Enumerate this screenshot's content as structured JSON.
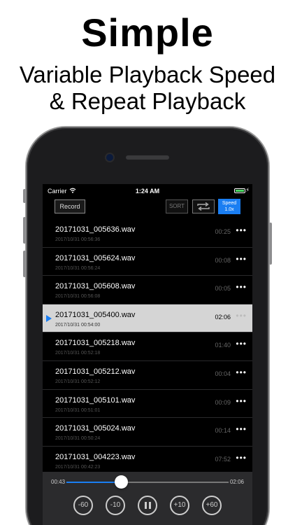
{
  "headline": {
    "title": "Simple",
    "subtitle_line1": "Variable Playback Speed",
    "subtitle_line2": "& Repeat Playback"
  },
  "status_bar": {
    "carrier": "Carrier",
    "time": "1:24 AM"
  },
  "toolbar": {
    "record_label": "Record",
    "sort_label": "SORT",
    "speed_label": "Speed",
    "speed_value": "1.0x"
  },
  "recordings": [
    {
      "name": "20171031_005636.wav",
      "date": "2017/10/31 00:56:36",
      "duration": "00:25",
      "selected": false
    },
    {
      "name": "20171031_005624.wav",
      "date": "2017/10/31 00:56:24",
      "duration": "00:08",
      "selected": false
    },
    {
      "name": "20171031_005608.wav",
      "date": "2017/10/31 00:56:08",
      "duration": "00:05",
      "selected": false
    },
    {
      "name": "20171031_005400.wav",
      "date": "2017/10/31 00:54:00",
      "duration": "02:06",
      "selected": true
    },
    {
      "name": "20171031_005218.wav",
      "date": "2017/10/31 00:52:18",
      "duration": "01:40",
      "selected": false
    },
    {
      "name": "20171031_005212.wav",
      "date": "2017/10/31 00:52:12",
      "duration": "00:04",
      "selected": false
    },
    {
      "name": "20171031_005101.wav",
      "date": "2017/10/31 00:51:01",
      "duration": "00:09",
      "selected": false
    },
    {
      "name": "20171031_005024.wav",
      "date": "2017/10/31 00:50:24",
      "duration": "00:14",
      "selected": false
    },
    {
      "name": "20171031_004223.wav",
      "date": "2017/10/31 00:42:23",
      "duration": "07:52",
      "selected": false
    }
  ],
  "more_glyph": "•••",
  "player": {
    "elapsed": "00:43",
    "total": "02:06",
    "progress": 0.34,
    "skip_back_60": "-60",
    "skip_back_10": "-10",
    "skip_fwd_10": "+10",
    "skip_fwd_60": "+60"
  },
  "colors": {
    "accent": "#1a7ef2",
    "selected_row": "#d5d5d5",
    "player_bg": "#2b2b2d"
  }
}
